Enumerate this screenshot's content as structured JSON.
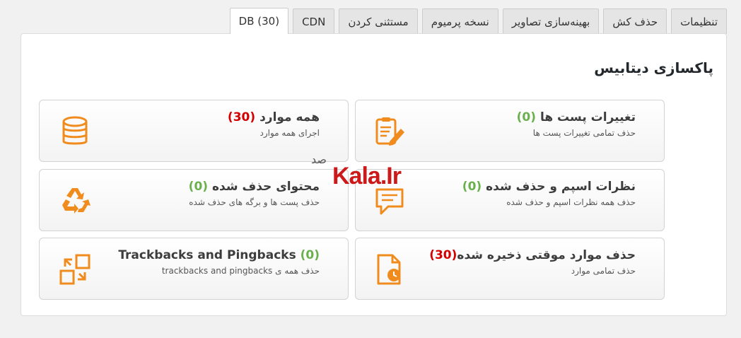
{
  "tabs": [
    {
      "label": "تنظیمات"
    },
    {
      "label": "حذف کش"
    },
    {
      "label": "بهینه‌سازی تصاویر"
    },
    {
      "label": "نسخه پرمیوم"
    },
    {
      "label": "مستثنی کردن"
    },
    {
      "label": "CDN"
    },
    {
      "label": "DB (30)"
    }
  ],
  "active_tab": "DB (30)",
  "panel": {
    "title": "پاکسازی دیتابیس"
  },
  "cards": {
    "all": {
      "title": "همه موارد",
      "count": "(30)",
      "desc": "اجرای همه موارد"
    },
    "revisions": {
      "title": "تغییرات پست ها",
      "count": "(0)",
      "desc": "حذف تمامی تغییرات پست ها"
    },
    "trashed": {
      "title": "محتوای حذف شده",
      "count": "(0)",
      "desc": "حذف پست ها و برگه های حذف شده"
    },
    "spam": {
      "title": "نظرات اسپم و حذف شده",
      "count": "(0)",
      "desc": "حذف همه نظرات اسپم و حذف شده"
    },
    "trackbacks": {
      "title": "Trackbacks and Pingbacks",
      "count": "(0)",
      "desc": "حذف همه ی trackbacks and pingbacks"
    },
    "transients": {
      "title": "حذف موارد موقتی ذخیره شده",
      "count": "(30)",
      "desc": "حذف تمامی موارد"
    }
  },
  "watermark": {
    "text": "Kala.Ir",
    "small": "صد"
  },
  "colors": {
    "icon_orange": "#f08c1e",
    "green": "#6ab04c",
    "red": "#d40000"
  },
  "icons": {
    "all": "database-icon",
    "revisions": "clipboard-pencil-icon",
    "trashed": "recycle-icon",
    "spam": "chat-bubble-icon",
    "trackbacks": "arrows-squares-icon",
    "transients": "file-clock-icon"
  }
}
